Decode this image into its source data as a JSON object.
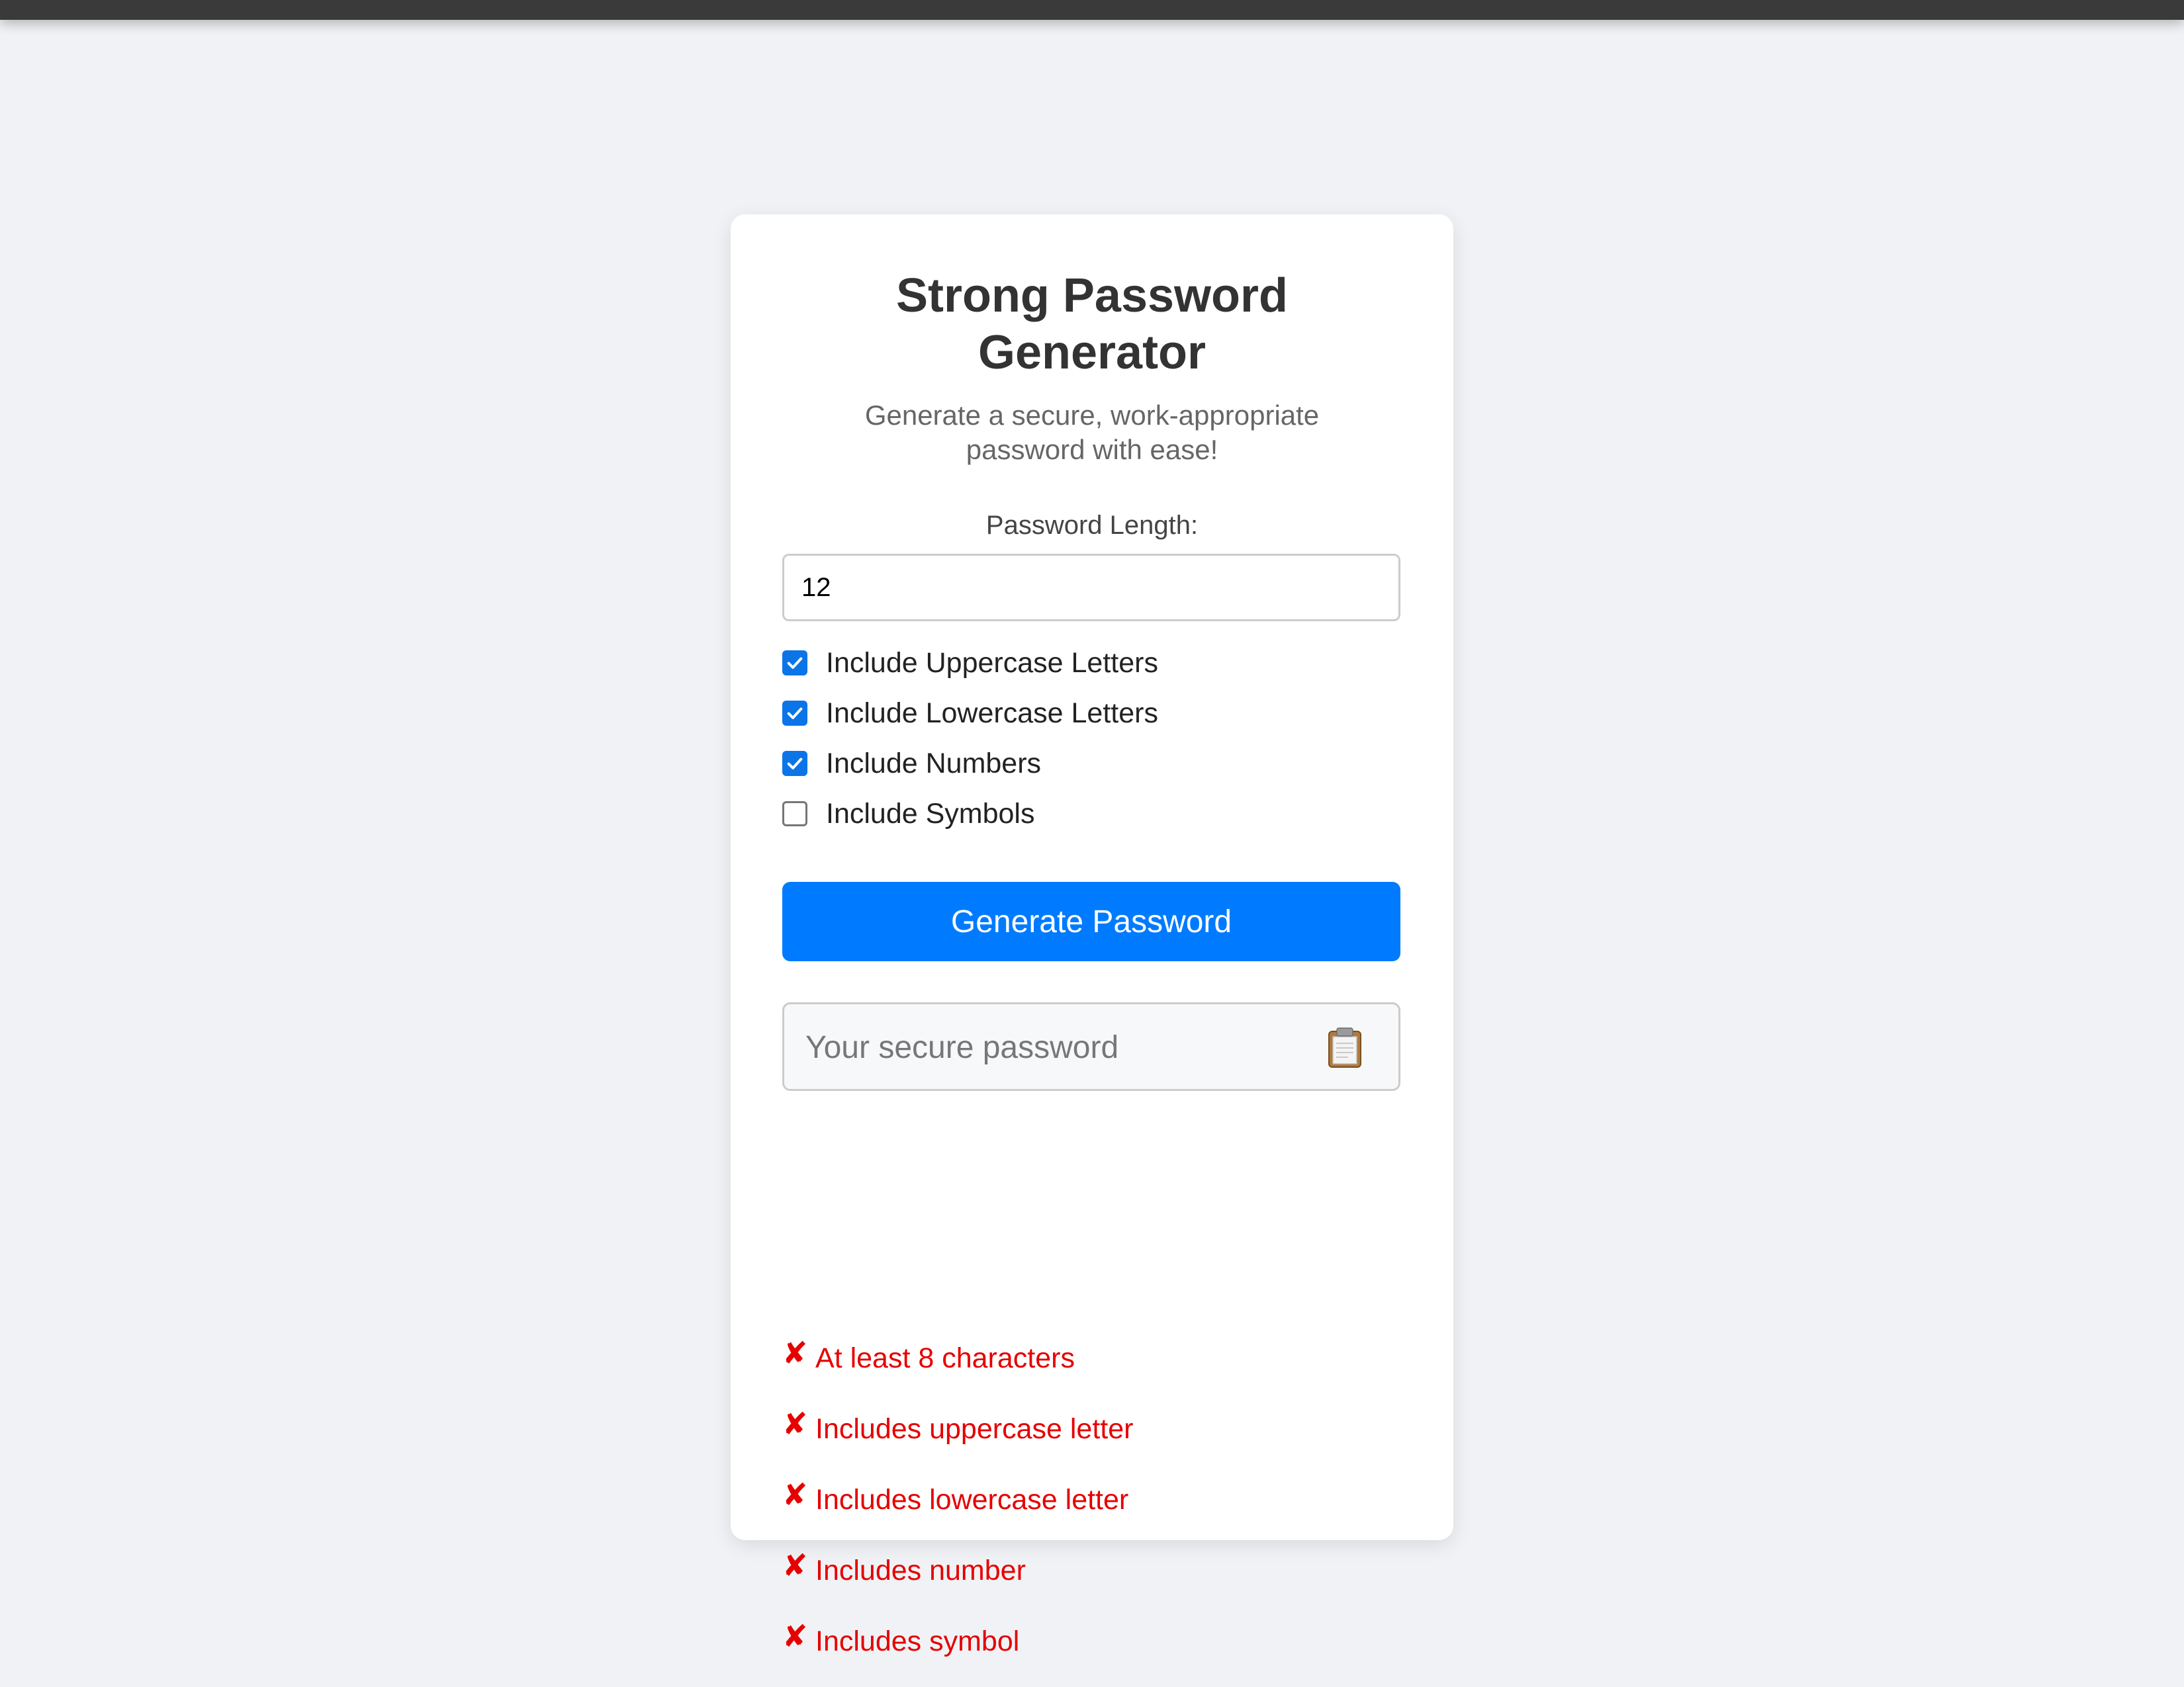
{
  "header": {
    "title": "Strong Password Generator",
    "subtitle": "Generate a secure, work-appropriate password with ease!"
  },
  "length": {
    "label": "Password Length:",
    "value": "12"
  },
  "options": [
    {
      "label": "Include Uppercase Letters",
      "checked": true
    },
    {
      "label": "Include Lowercase Letters",
      "checked": true
    },
    {
      "label": "Include Numbers",
      "checked": true
    },
    {
      "label": "Include Symbols",
      "checked": false
    }
  ],
  "generate_button": {
    "label": "Generate Password"
  },
  "output": {
    "placeholder": "Your secure password",
    "value": "",
    "copy_icon": "clipboard-icon"
  },
  "criteria": [
    {
      "mark": "✘",
      "text": "At least 8 characters",
      "met": false
    },
    {
      "mark": "✘",
      "text": "Includes uppercase letter",
      "met": false
    },
    {
      "mark": "✘",
      "text": "Includes lowercase letter",
      "met": false
    },
    {
      "mark": "✘",
      "text": "Includes number",
      "met": false
    },
    {
      "mark": "✘",
      "text": "Includes symbol",
      "met": false
    }
  ],
  "colors": {
    "background": "#f0f2f5",
    "card": "#ffffff",
    "accent": "#007bff",
    "checkbox": "#0b75e8",
    "criteria_unmet": "#e60000",
    "title": "#333333",
    "subtitle": "#666666"
  }
}
